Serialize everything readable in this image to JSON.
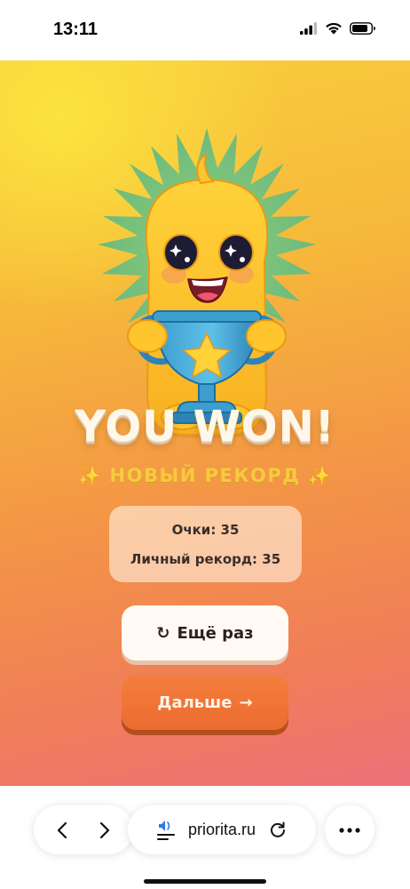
{
  "status_bar": {
    "time": "13:11",
    "icons": [
      "cellular-signal-icon",
      "wifi-icon",
      "battery-icon"
    ]
  },
  "game": {
    "title": "YOU WON!",
    "sparkle_left": "✨",
    "subtitle": "НОВЫЙ РЕКОРД",
    "sparkle_right": "✨",
    "score": {
      "points_line": "Очки: 35",
      "record_line": "Личный рекорд: 35"
    },
    "buttons": {
      "retry_icon": "↻",
      "retry_label": "Ещё раз",
      "next_label": "Дальше",
      "next_icon": "→"
    },
    "colors": {
      "gradient_top": "#f9cf3d",
      "gradient_bottom": "#ee7079",
      "accent_orange": "#ec6c2f",
      "subtitle_gold": "#f7cb3c"
    }
  },
  "browser": {
    "url": "priorita.ru",
    "back_icon": "chevron-left-icon",
    "forward_icon": "chevron-right-icon",
    "page_icon": "speaker-reader-icon",
    "reload_icon": "reload-icon",
    "more_icon": "more-dots-icon"
  }
}
